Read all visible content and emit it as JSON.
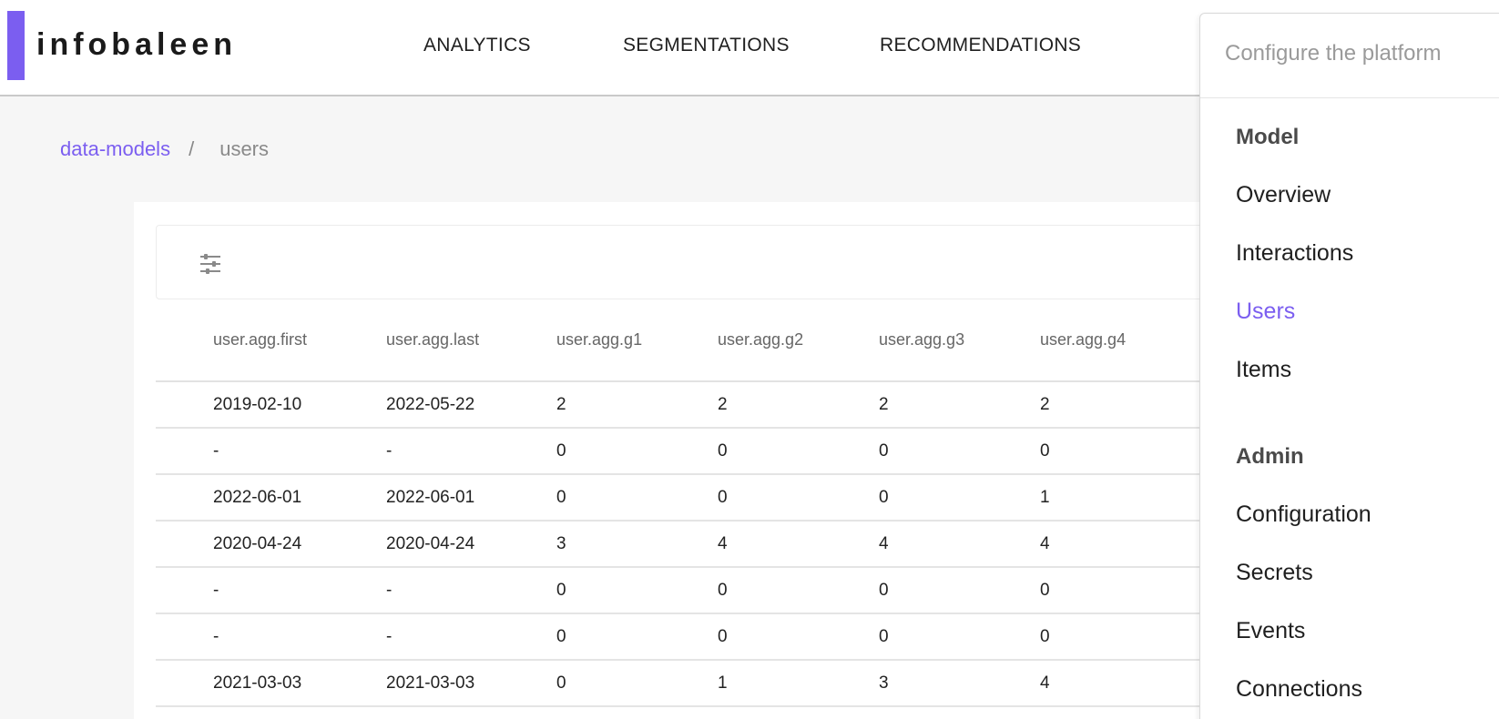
{
  "header": {
    "logo_text": "infobaleen",
    "brand_color": "#7b5ef0",
    "nav": {
      "analytics": "ANALYTICS",
      "segmentations": "SEGMENTATIONS",
      "recommendations": "RECOMMENDATIONS"
    }
  },
  "breadcrumb": {
    "parent": "data-models",
    "separator": "/",
    "current": "users"
  },
  "toolbar": {
    "filter_icon": "sliders-icon"
  },
  "table": {
    "columns": [
      "user.agg.first",
      "user.agg.last",
      "user.agg.g1",
      "user.agg.g2",
      "user.agg.g3",
      "user.agg.g4"
    ],
    "rows": [
      [
        "2019-02-10",
        "2022-05-22",
        "2",
        "2",
        "2",
        "2"
      ],
      [
        "-",
        "-",
        "0",
        "0",
        "0",
        "0"
      ],
      [
        "2022-06-01",
        "2022-06-01",
        "0",
        "0",
        "0",
        "1"
      ],
      [
        "2020-04-24",
        "2020-04-24",
        "3",
        "4",
        "4",
        "4"
      ],
      [
        "-",
        "-",
        "0",
        "0",
        "0",
        "0"
      ],
      [
        "-",
        "-",
        "0",
        "0",
        "0",
        "0"
      ],
      [
        "2021-03-03",
        "2021-03-03",
        "0",
        "1",
        "3",
        "4"
      ]
    ]
  },
  "panel": {
    "title": "Configure the platform",
    "sections": [
      {
        "heading": "Model",
        "items": [
          {
            "label": "Overview",
            "active": false
          },
          {
            "label": "Interactions",
            "active": false
          },
          {
            "label": "Users",
            "active": true
          },
          {
            "label": "Items",
            "active": false
          }
        ]
      },
      {
        "heading": "Admin",
        "items": [
          {
            "label": "Configuration",
            "active": false
          },
          {
            "label": "Secrets",
            "active": false
          },
          {
            "label": "Events",
            "active": false
          },
          {
            "label": "Connections",
            "active": false
          }
        ]
      }
    ]
  }
}
